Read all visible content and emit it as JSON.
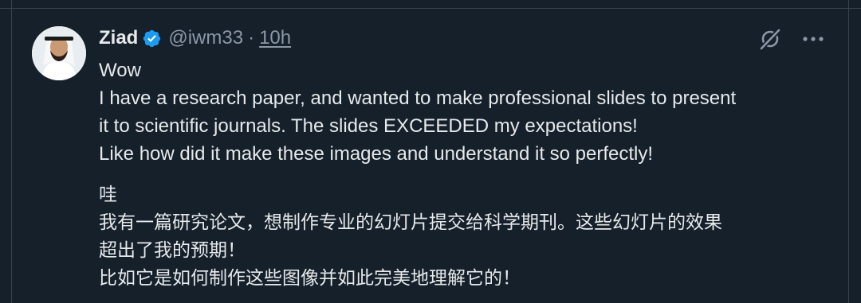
{
  "tweet": {
    "author": {
      "display_name": "Ziad",
      "handle": "@iwm33",
      "verified": true
    },
    "separator": "·",
    "time": "10h",
    "text_en": [
      "Wow",
      "I have a research paper, and wanted to make professional slides to present",
      "it to scientific journals. The slides EXCEEDED my expectations!",
      "Like how did it make these images and understand it so perfectly!"
    ],
    "text_zh": [
      "哇",
      "我有一篇研究论文，想制作专业的幻灯片提交给科学期刊。这些幻灯片的效果",
      "超出了我的预期！",
      "比如它是如何制作这些图像并如此完美地理解它的！"
    ]
  },
  "icons": {
    "verified": "verified-badge-icon",
    "grok": "grok-icon",
    "more": "more-icon"
  },
  "colors": {
    "background": "#15202b",
    "text": "#e7e9ea",
    "secondary": "#8b98a5",
    "verified": "#1d9bf0",
    "border": "#38444d"
  }
}
